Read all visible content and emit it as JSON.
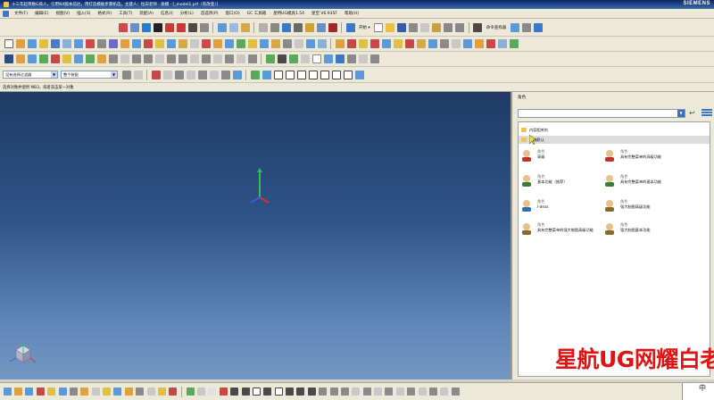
{
  "window": {
    "title": "十三年起草数G商人，引用NX版本前达，用打造模板步骤机选，主建人：恒白老师 · 质模 · [_model1.prt（有改变）]",
    "brand": "SIEMENS"
  },
  "menu": {
    "app_icon": "nx-app-icon",
    "items": [
      "开始 ▾",
      "文件(F)",
      "编辑(E)",
      "视图(V)",
      "插入(S)",
      "格式(R)",
      "工具(T)",
      "装配(A)",
      "信息(I)",
      "分析(L)",
      "首选项(P)",
      "窗口(O)",
      "GC 工具箱",
      "星特UG模具1.54",
      "星空 V6.935F",
      "帮助(H)"
    ]
  },
  "toolbar_row1": {
    "start_label": "开始 ▾",
    "command_finder": "命令查找器"
  },
  "toolbar_row4": {
    "filter_value": "没有选择过滤器",
    "scope_value": "整个装配"
  },
  "status": {
    "prompt": "选择对象并使用 MB3，或者双击某一对象"
  },
  "panel": {
    "header": "角色",
    "search_value": "",
    "groups": [
      {
        "label": "内容相关的",
        "selected": false
      },
      {
        "label": "系统默认",
        "selected": true
      }
    ],
    "roles": [
      {
        "type": "角色",
        "name": "高级",
        "icon": "role-advanced-icon",
        "color": "#c03030"
      },
      {
        "type": "角色",
        "name": "具有完整菜单的高级功能",
        "icon": "role-advanced-full-menu-icon",
        "color": "#c03030"
      },
      {
        "type": "角色",
        "name": "基本功能（推荐）",
        "icon": "role-essentials-icon",
        "color": "#3a7a3a"
      },
      {
        "type": "角色",
        "name": "具有完整菜单的基本功能",
        "icon": "role-essentials-full-menu-icon",
        "color": "#3a7a3a"
      },
      {
        "type": "角色",
        "name": "I-deas",
        "icon": "role-ideas-icon",
        "color": "#2f6db0"
      },
      {
        "type": "角色",
        "name": "强大制图高级功能",
        "icon": "role-drafting-advanced-icon",
        "color": "#8a6a2a"
      },
      {
        "type": "角色",
        "name": "具有完整菜单的强大制图高级功能",
        "icon": "role-drafting-full-icon",
        "color": "#8a6a2a"
      },
      {
        "type": "角色",
        "name": "强大制图基本功能",
        "icon": "role-drafting-basic-icon",
        "color": "#8a6a2a"
      }
    ]
  },
  "watermark": "星航UG网耀白老师",
  "ime": {
    "char": "中"
  },
  "colors": {
    "toolbar_bg": "#ece9d8",
    "viewport_top": "#1f3a66",
    "viewport_bottom": "#7497c2",
    "watermark": "#e01414",
    "axis_x": "#e03030",
    "axis_y": "#30c050",
    "axis_z": "#3060e0"
  }
}
